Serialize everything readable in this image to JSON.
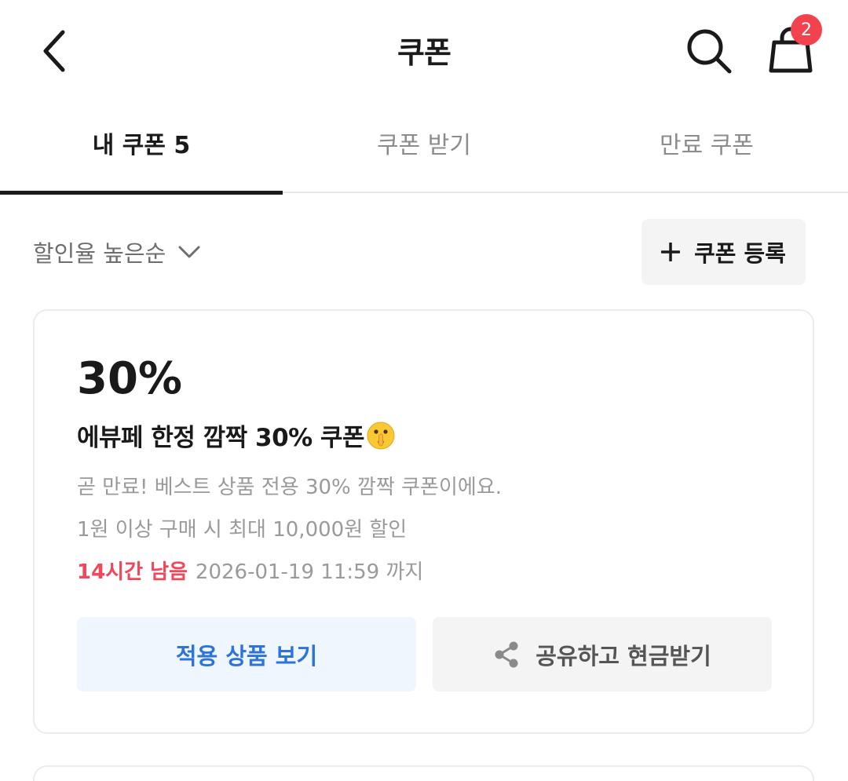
{
  "header": {
    "title": "쿠폰",
    "cart_count": "2",
    "icons": {
      "back": "chevron-left-icon",
      "search": "search-icon",
      "cart": "shopping-bag-icon"
    }
  },
  "tabs": [
    {
      "label": "내 쿠폰 5",
      "active": true
    },
    {
      "label": "쿠폰 받기",
      "active": false
    },
    {
      "label": "만료 쿠폰",
      "active": false
    }
  ],
  "toolbar": {
    "sort_label": "할인율 높은순",
    "register_label": "쿠폰 등록"
  },
  "coupon": {
    "discount": "30%",
    "name": "에뷰페 한정 깜짝 30% 쿠폰",
    "name_emoji": "shushing-face-emoji",
    "description": "곧 만료! 베스트 상품 전용 30% 깜짝 쿠폰이에요.",
    "condition": "1원 이상 구매 시 최대 10,000원 할인",
    "remaining": "14시간 남음",
    "expiry": "2026-01-19 11:59 까지",
    "apply_label": "적용 상품 보기",
    "share_label": "공유하고 현금받기"
  },
  "colors": {
    "accent_red": "#f0485a",
    "badge_red": "#f2424e",
    "link_blue": "#2e73d6",
    "apply_bg": "#f0f6fd"
  }
}
